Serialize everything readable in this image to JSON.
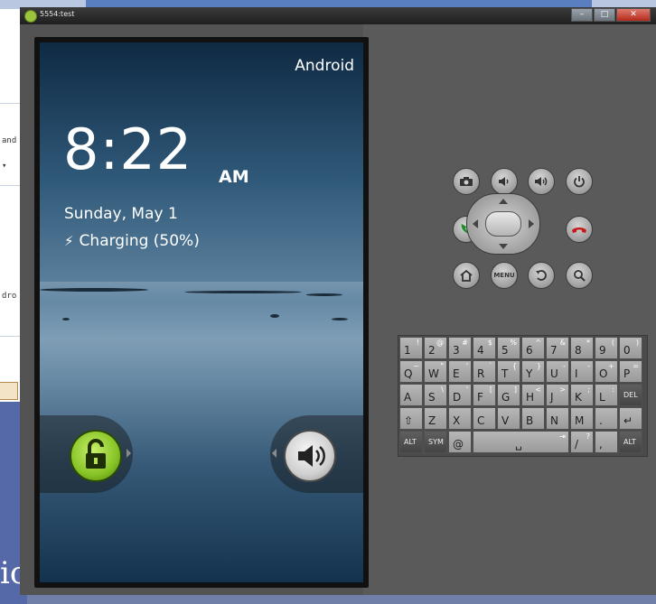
{
  "window": {
    "title": "5554:test"
  },
  "background": {
    "left_fragments": [
      "and",
      "▾",
      "dro"
    ],
    "bottom_fragment": "ic"
  },
  "lockscreen": {
    "carrier": "Android",
    "time": "8:22",
    "ampm": "AM",
    "date": "Sunday, May 1",
    "charging": "Charging (50%)",
    "unlock_icon": "lock-open-icon",
    "sound_icon": "speaker-icon"
  },
  "hardware": {
    "row1": [
      {
        "name": "camera",
        "glyph": "📷"
      },
      {
        "name": "volume-down",
        "glyph": "🔉"
      },
      {
        "name": "volume-up",
        "glyph": "🔊"
      },
      {
        "name": "power",
        "glyph": "⏻"
      }
    ],
    "call_glyph": "✆",
    "endcall_glyph": "✆",
    "row3": [
      {
        "name": "home",
        "glyph": "⌂"
      },
      {
        "name": "menu",
        "glyph": "MENU"
      },
      {
        "name": "back",
        "glyph": "↺"
      },
      {
        "name": "search",
        "glyph": "⚲"
      }
    ]
  },
  "keyboard": {
    "rows": [
      [
        {
          "m": "1",
          "s": "!"
        },
        {
          "m": "2",
          "s": "@"
        },
        {
          "m": "3",
          "s": "#"
        },
        {
          "m": "4",
          "s": "$"
        },
        {
          "m": "5",
          "s": "%"
        },
        {
          "m": "6",
          "s": "^"
        },
        {
          "m": "7",
          "s": "&"
        },
        {
          "m": "8",
          "s": "*"
        },
        {
          "m": "9",
          "s": "("
        },
        {
          "m": "0",
          "s": ")"
        }
      ],
      [
        {
          "m": "Q",
          "s": "~"
        },
        {
          "m": "W",
          "s": "\""
        },
        {
          "m": "E",
          "s": "'"
        },
        {
          "m": "R",
          "s": "`"
        },
        {
          "m": "T",
          "s": "{"
        },
        {
          "m": "Y",
          "s": "}"
        },
        {
          "m": "U",
          "s": "-"
        },
        {
          "m": "I",
          "s": "-"
        },
        {
          "m": "O",
          "s": "+"
        },
        {
          "m": "P",
          "s": "="
        }
      ],
      [
        {
          "m": "A",
          "s": ""
        },
        {
          "m": "S",
          "s": "\\"
        },
        {
          "m": "D",
          "s": "'"
        },
        {
          "m": "F",
          "s": "["
        },
        {
          "m": "G",
          "s": "]"
        },
        {
          "m": "H",
          "s": "<"
        },
        {
          "m": "J",
          "s": ">"
        },
        {
          "m": "K",
          "s": ";"
        },
        {
          "m": "L",
          "s": ":"
        },
        {
          "m": "DEL",
          "s": ""
        }
      ],
      [
        {
          "m": "⇧",
          "s": ""
        },
        {
          "m": "Z",
          "s": ""
        },
        {
          "m": "X",
          "s": ""
        },
        {
          "m": "C",
          "s": ""
        },
        {
          "m": "V",
          "s": ""
        },
        {
          "m": "B",
          "s": ""
        },
        {
          "m": "N",
          "s": ""
        },
        {
          "m": "M",
          "s": ""
        },
        {
          "m": ".",
          "s": ""
        },
        {
          "m": "↵",
          "s": ""
        }
      ],
      [
        {
          "m": "ALT",
          "s": ""
        },
        {
          "m": "SYM",
          "s": ""
        },
        {
          "m": "@",
          "s": ""
        },
        {
          "m": "␣",
          "s": "⇥"
        },
        {
          "m": "/",
          "s": "?"
        },
        {
          "m": ",",
          "s": ""
        },
        {
          "m": "ALT",
          "s": ""
        }
      ]
    ]
  }
}
